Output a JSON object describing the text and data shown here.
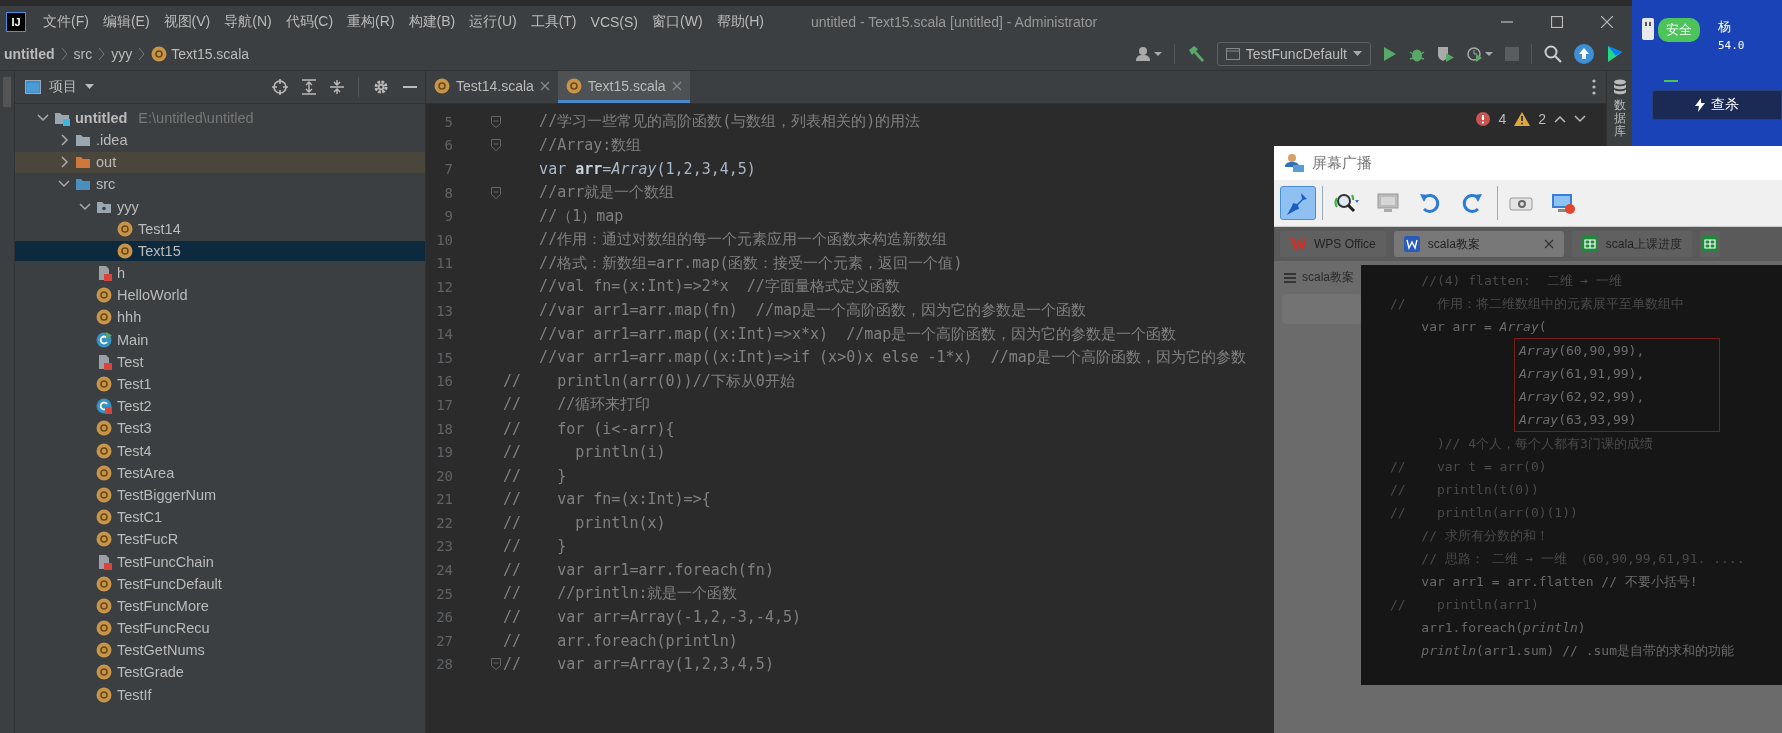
{
  "menu_bar": {
    "logo": "IJ",
    "menus": [
      "文件(F)",
      "编辑(E)",
      "视图(V)",
      "导航(N)",
      "代码(C)",
      "重构(R)",
      "构建(B)",
      "运行(U)",
      "工具(T)",
      "VCS(S)",
      "窗口(W)",
      "帮助(H)"
    ],
    "title": "untitled - Text15.scala [untitled] - Administrator"
  },
  "nav_bar": {
    "breadcrumbs": [
      {
        "label": "untitled",
        "kind": "project"
      },
      {
        "label": "src",
        "kind": "folder"
      },
      {
        "label": "yyy",
        "kind": "folder"
      },
      {
        "label": "Text15.scala",
        "kind": "object"
      }
    ],
    "run_config": "TestFuncDefault"
  },
  "project_panel": {
    "title": "项目",
    "tree": [
      {
        "label": "untitled",
        "path": "E:\\untitled\\untitled",
        "kind": "module",
        "expanded": true,
        "selected": false,
        "children": [
          {
            "label": ".idea",
            "kind": "folder",
            "expanded": false,
            "selected": false
          },
          {
            "label": "out",
            "kind": "excluded",
            "expanded": false,
            "selected": false
          },
          {
            "label": "src",
            "kind": "source",
            "expanded": true,
            "selected": false,
            "children": [
              {
                "label": "yyy",
                "kind": "package",
                "expanded": true,
                "selected": false,
                "children": [
                  {
                    "label": "Test14",
                    "kind": "object",
                    "selected": false
                  },
                  {
                    "label": "Text15",
                    "kind": "object",
                    "selected": true
                  }
                ]
              },
              {
                "label": "h",
                "kind": "file",
                "selected": false
              },
              {
                "label": "HelloWorld",
                "kind": "object",
                "selected": false
              },
              {
                "label": "hhh",
                "kind": "object",
                "selected": false
              },
              {
                "label": "Main",
                "kind": "runnable",
                "selected": false
              },
              {
                "label": "Test",
                "kind": "file",
                "selected": false
              },
              {
                "label": "Test1",
                "kind": "object",
                "selected": false
              },
              {
                "label": "Test2",
                "kind": "class",
                "selected": false
              },
              {
                "label": "Test3",
                "kind": "object",
                "selected": false
              },
              {
                "label": "Test4",
                "kind": "object",
                "selected": false
              },
              {
                "label": "TestArea",
                "kind": "object",
                "selected": false
              },
              {
                "label": "TestBiggerNum",
                "kind": "object",
                "selected": false
              },
              {
                "label": "TestC1",
                "kind": "object",
                "selected": false
              },
              {
                "label": "TestFucR",
                "kind": "object",
                "selected": false
              },
              {
                "label": "TestFuncChain",
                "kind": "file",
                "selected": false
              },
              {
                "label": "TestFuncDefault",
                "kind": "object",
                "selected": false
              },
              {
                "label": "TestFuncMore",
                "kind": "object",
                "selected": false
              },
              {
                "label": "TestFuncRecu",
                "kind": "object",
                "selected": false
              },
              {
                "label": "TestGetNums",
                "kind": "object",
                "selected": false
              },
              {
                "label": "TestGrade",
                "kind": "object",
                "selected": false
              },
              {
                "label": "TestIf",
                "kind": "object",
                "selected": false
              }
            ]
          }
        ]
      }
    ]
  },
  "editor": {
    "tabs": [
      {
        "label": "Test14.scala",
        "selected": false
      },
      {
        "label": "Text15.scala",
        "selected": true
      }
    ],
    "errors": "4",
    "warnings": "2",
    "lines": [
      {
        "number": "5",
        "text": "    //学习一些常见的高阶函数(与数组，列表相关的)的用法",
        "kind": "comment",
        "fold": true
      },
      {
        "number": "6",
        "text": "    //Array:数组",
        "kind": "comment",
        "fold": true
      },
      {
        "number": "7",
        "text": "    var **arr**=*Array*(1,2,3,4,5)",
        "kind": "code",
        "fold": false
      },
      {
        "number": "8",
        "text": "    //arr就是一个数组",
        "kind": "comment",
        "fold": true
      },
      {
        "number": "9",
        "text": "    //（1）map",
        "kind": "comment",
        "fold": false
      },
      {
        "number": "10",
        "text": "    //作用：通过对数组的每一个元素应用一个函数来构造新数组",
        "kind": "comment",
        "fold": false
      },
      {
        "number": "11",
        "text": "    //格式：新数组=arr.map(函数：接受一个元素，返回一个值)",
        "kind": "comment",
        "fold": false
      },
      {
        "number": "12",
        "text": "    //val fn=(x:Int)=>2*x  //字面量格式定义函数",
        "kind": "comment",
        "fold": false
      },
      {
        "number": "13",
        "text": "    //var arr1=arr.map(fn)  //map是一个高阶函数，因为它的参数是一个函数",
        "kind": "comment",
        "fold": false
      },
      {
        "number": "14",
        "text": "    //var arr1=arr.map((x:Int)=>x*x)  //map是一个高阶函数，因为它的参数是一个函数",
        "kind": "comment",
        "fold": false
      },
      {
        "number": "15",
        "text": "    //var arr1=arr.map((x:Int)=>if (x>0)x else -1*x)  //map是一个高阶函数，因为它的参数",
        "kind": "comment",
        "fold": false
      },
      {
        "number": "16",
        "text": "//    println(arr(0))//下标从0开始",
        "kind": "comment",
        "fold": false
      },
      {
        "number": "17",
        "text": "//    //循环来打印",
        "kind": "comment",
        "fold": false
      },
      {
        "number": "18",
        "text": "//    for (i<-arr){",
        "kind": "comment",
        "fold": false
      },
      {
        "number": "19",
        "text": "//      println(i)",
        "kind": "comment",
        "fold": false
      },
      {
        "number": "20",
        "text": "//    }",
        "kind": "comment",
        "fold": false
      },
      {
        "number": "21",
        "text": "//    var fn=(x:Int)=>{",
        "kind": "comment",
        "fold": false
      },
      {
        "number": "22",
        "text": "//      println(x)",
        "kind": "comment",
        "fold": false
      },
      {
        "number": "23",
        "text": "//    }",
        "kind": "comment",
        "fold": false
      },
      {
        "number": "24",
        "text": "//    var arr1=arr.foreach(fn)",
        "kind": "comment",
        "fold": false
      },
      {
        "number": "25",
        "text": "//    //println:就是一个函数",
        "kind": "comment",
        "fold": false
      },
      {
        "number": "26",
        "text": "//    var arr=Array(-1,2,-3,-4,5)",
        "kind": "comment",
        "fold": false
      },
      {
        "number": "27",
        "text": "//    arr.foreach(println)",
        "kind": "comment",
        "fold": false
      },
      {
        "number": "28",
        "text": "//    var arr=Array(1,2,3,4,5)",
        "kind": "comment",
        "fold": true
      }
    ]
  },
  "right_strip": {
    "label": "数据库"
  },
  "security_widget": {
    "badge": "安全",
    "name": "杨",
    "value": "54.0",
    "button": "查杀"
  },
  "broadcast_window": {
    "title": "屏幕广播",
    "toolbar": [
      {
        "kind": "pin",
        "selected": true,
        "divider_after": true
      },
      {
        "kind": "zoom",
        "selected": false,
        "divider_after": false
      },
      {
        "kind": "monitor",
        "selected": false,
        "divider_after": false
      },
      {
        "kind": "undo",
        "selected": false,
        "divider_after": false
      },
      {
        "kind": "redo",
        "selected": false,
        "divider_after": true
      },
      {
        "kind": "camera",
        "selected": false,
        "divider_after": false
      },
      {
        "kind": "record",
        "selected": false,
        "divider_after": false
      }
    ],
    "tabs": [
      {
        "label": "WPS Office",
        "kind": "wps",
        "selected": false,
        "closable": false
      },
      {
        "label": "scala教案",
        "kind": "word",
        "selected": true,
        "closable": true
      },
      {
        "label": "scala上课进度",
        "kind": "sheet",
        "selected": false,
        "closable": false
      },
      {
        "kind": "sheet",
        "selected": false,
        "closable": false
      }
    ],
    "doc_title": "scala教案",
    "code_lines": [
      {
        "text": "    //(4) flatten:  二维 → 一维",
        "kind": "comment",
        "boxed": false
      },
      {
        "text": "//    作用：将二维数组中的元素展平至单数组中",
        "kind": "comment",
        "boxed": false
      },
      {
        "text": "    var arr = *Array*(",
        "kind": "code",
        "boxed": false
      },
      {
        "text": "*Array*(60,90,99),",
        "kind": "code",
        "boxed": true
      },
      {
        "text": "*Array*(61,91,99),",
        "kind": "code",
        "boxed": true
      },
      {
        "text": "*Array*(62,92,99),",
        "kind": "code",
        "boxed": true
      },
      {
        "text": "*Array*(63,93,99)",
        "kind": "code",
        "boxed": true
      },
      {
        "text": "      )// 4个人，每个人都有3门课的成绩",
        "kind": "comment",
        "boxed": false
      },
      {
        "text": "//    var t = arr(0)",
        "kind": "comment",
        "boxed": false
      },
      {
        "text": "//    println(t(0))",
        "kind": "comment",
        "boxed": false
      },
      {
        "text": "//    println(arr(0)(1))",
        "kind": "comment",
        "boxed": false
      },
      {
        "text": "    // 求所有分数的和！",
        "kind": "comment",
        "boxed": false
      },
      {
        "text": "    // 思路： 二维 → 一维 （60,90,99,61,91. ....",
        "kind": "comment",
        "boxed": false
      },
      {
        "text": "    var arr1 = arr.flatten // 不要小括号!",
        "kind": "code",
        "boxed": false
      },
      {
        "text": "//    println(arr1)",
        "kind": "comment",
        "boxed": false
      },
      {
        "text": "    arr1.foreach(*println*)",
        "kind": "code",
        "boxed": false
      },
      {
        "text": "    *println*(arr1.sum) // .sum是自带的求和的功能",
        "kind": "code",
        "boxed": false
      }
    ]
  }
}
